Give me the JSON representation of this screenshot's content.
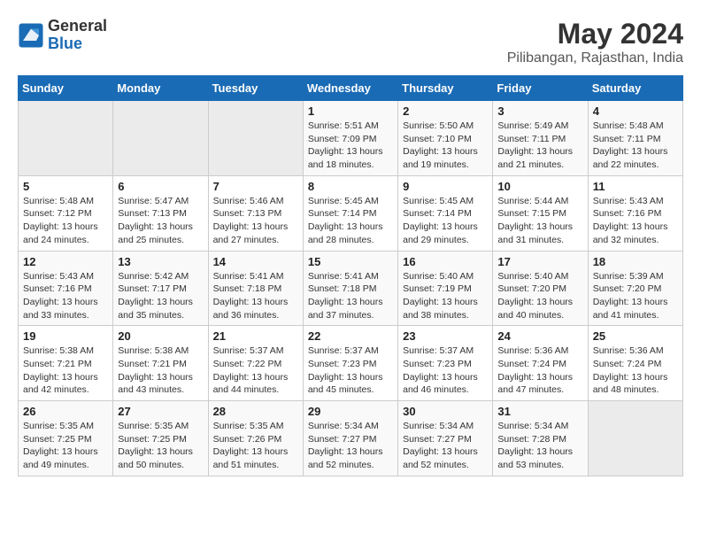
{
  "header": {
    "logo_general": "General",
    "logo_blue": "Blue",
    "month_year": "May 2024",
    "location": "Pilibangan, Rajasthan, India"
  },
  "weekdays": [
    "Sunday",
    "Monday",
    "Tuesday",
    "Wednesday",
    "Thursday",
    "Friday",
    "Saturday"
  ],
  "weeks": [
    [
      {
        "day": "",
        "sunrise": "",
        "sunset": "",
        "daylight": ""
      },
      {
        "day": "",
        "sunrise": "",
        "sunset": "",
        "daylight": ""
      },
      {
        "day": "",
        "sunrise": "",
        "sunset": "",
        "daylight": ""
      },
      {
        "day": "1",
        "sunrise": "Sunrise: 5:51 AM",
        "sunset": "Sunset: 7:09 PM",
        "daylight": "Daylight: 13 hours and 18 minutes."
      },
      {
        "day": "2",
        "sunrise": "Sunrise: 5:50 AM",
        "sunset": "Sunset: 7:10 PM",
        "daylight": "Daylight: 13 hours and 19 minutes."
      },
      {
        "day": "3",
        "sunrise": "Sunrise: 5:49 AM",
        "sunset": "Sunset: 7:11 PM",
        "daylight": "Daylight: 13 hours and 21 minutes."
      },
      {
        "day": "4",
        "sunrise": "Sunrise: 5:48 AM",
        "sunset": "Sunset: 7:11 PM",
        "daylight": "Daylight: 13 hours and 22 minutes."
      }
    ],
    [
      {
        "day": "5",
        "sunrise": "Sunrise: 5:48 AM",
        "sunset": "Sunset: 7:12 PM",
        "daylight": "Daylight: 13 hours and 24 minutes."
      },
      {
        "day": "6",
        "sunrise": "Sunrise: 5:47 AM",
        "sunset": "Sunset: 7:13 PM",
        "daylight": "Daylight: 13 hours and 25 minutes."
      },
      {
        "day": "7",
        "sunrise": "Sunrise: 5:46 AM",
        "sunset": "Sunset: 7:13 PM",
        "daylight": "Daylight: 13 hours and 27 minutes."
      },
      {
        "day": "8",
        "sunrise": "Sunrise: 5:45 AM",
        "sunset": "Sunset: 7:14 PM",
        "daylight": "Daylight: 13 hours and 28 minutes."
      },
      {
        "day": "9",
        "sunrise": "Sunrise: 5:45 AM",
        "sunset": "Sunset: 7:14 PM",
        "daylight": "Daylight: 13 hours and 29 minutes."
      },
      {
        "day": "10",
        "sunrise": "Sunrise: 5:44 AM",
        "sunset": "Sunset: 7:15 PM",
        "daylight": "Daylight: 13 hours and 31 minutes."
      },
      {
        "day": "11",
        "sunrise": "Sunrise: 5:43 AM",
        "sunset": "Sunset: 7:16 PM",
        "daylight": "Daylight: 13 hours and 32 minutes."
      }
    ],
    [
      {
        "day": "12",
        "sunrise": "Sunrise: 5:43 AM",
        "sunset": "Sunset: 7:16 PM",
        "daylight": "Daylight: 13 hours and 33 minutes."
      },
      {
        "day": "13",
        "sunrise": "Sunrise: 5:42 AM",
        "sunset": "Sunset: 7:17 PM",
        "daylight": "Daylight: 13 hours and 35 minutes."
      },
      {
        "day": "14",
        "sunrise": "Sunrise: 5:41 AM",
        "sunset": "Sunset: 7:18 PM",
        "daylight": "Daylight: 13 hours and 36 minutes."
      },
      {
        "day": "15",
        "sunrise": "Sunrise: 5:41 AM",
        "sunset": "Sunset: 7:18 PM",
        "daylight": "Daylight: 13 hours and 37 minutes."
      },
      {
        "day": "16",
        "sunrise": "Sunrise: 5:40 AM",
        "sunset": "Sunset: 7:19 PM",
        "daylight": "Daylight: 13 hours and 38 minutes."
      },
      {
        "day": "17",
        "sunrise": "Sunrise: 5:40 AM",
        "sunset": "Sunset: 7:20 PM",
        "daylight": "Daylight: 13 hours and 40 minutes."
      },
      {
        "day": "18",
        "sunrise": "Sunrise: 5:39 AM",
        "sunset": "Sunset: 7:20 PM",
        "daylight": "Daylight: 13 hours and 41 minutes."
      }
    ],
    [
      {
        "day": "19",
        "sunrise": "Sunrise: 5:38 AM",
        "sunset": "Sunset: 7:21 PM",
        "daylight": "Daylight: 13 hours and 42 minutes."
      },
      {
        "day": "20",
        "sunrise": "Sunrise: 5:38 AM",
        "sunset": "Sunset: 7:21 PM",
        "daylight": "Daylight: 13 hours and 43 minutes."
      },
      {
        "day": "21",
        "sunrise": "Sunrise: 5:37 AM",
        "sunset": "Sunset: 7:22 PM",
        "daylight": "Daylight: 13 hours and 44 minutes."
      },
      {
        "day": "22",
        "sunrise": "Sunrise: 5:37 AM",
        "sunset": "Sunset: 7:23 PM",
        "daylight": "Daylight: 13 hours and 45 minutes."
      },
      {
        "day": "23",
        "sunrise": "Sunrise: 5:37 AM",
        "sunset": "Sunset: 7:23 PM",
        "daylight": "Daylight: 13 hours and 46 minutes."
      },
      {
        "day": "24",
        "sunrise": "Sunrise: 5:36 AM",
        "sunset": "Sunset: 7:24 PM",
        "daylight": "Daylight: 13 hours and 47 minutes."
      },
      {
        "day": "25",
        "sunrise": "Sunrise: 5:36 AM",
        "sunset": "Sunset: 7:24 PM",
        "daylight": "Daylight: 13 hours and 48 minutes."
      }
    ],
    [
      {
        "day": "26",
        "sunrise": "Sunrise: 5:35 AM",
        "sunset": "Sunset: 7:25 PM",
        "daylight": "Daylight: 13 hours and 49 minutes."
      },
      {
        "day": "27",
        "sunrise": "Sunrise: 5:35 AM",
        "sunset": "Sunset: 7:25 PM",
        "daylight": "Daylight: 13 hours and 50 minutes."
      },
      {
        "day": "28",
        "sunrise": "Sunrise: 5:35 AM",
        "sunset": "Sunset: 7:26 PM",
        "daylight": "Daylight: 13 hours and 51 minutes."
      },
      {
        "day": "29",
        "sunrise": "Sunrise: 5:34 AM",
        "sunset": "Sunset: 7:27 PM",
        "daylight": "Daylight: 13 hours and 52 minutes."
      },
      {
        "day": "30",
        "sunrise": "Sunrise: 5:34 AM",
        "sunset": "Sunset: 7:27 PM",
        "daylight": "Daylight: 13 hours and 52 minutes."
      },
      {
        "day": "31",
        "sunrise": "Sunrise: 5:34 AM",
        "sunset": "Sunset: 7:28 PM",
        "daylight": "Daylight: 13 hours and 53 minutes."
      },
      {
        "day": "",
        "sunrise": "",
        "sunset": "",
        "daylight": ""
      }
    ]
  ]
}
